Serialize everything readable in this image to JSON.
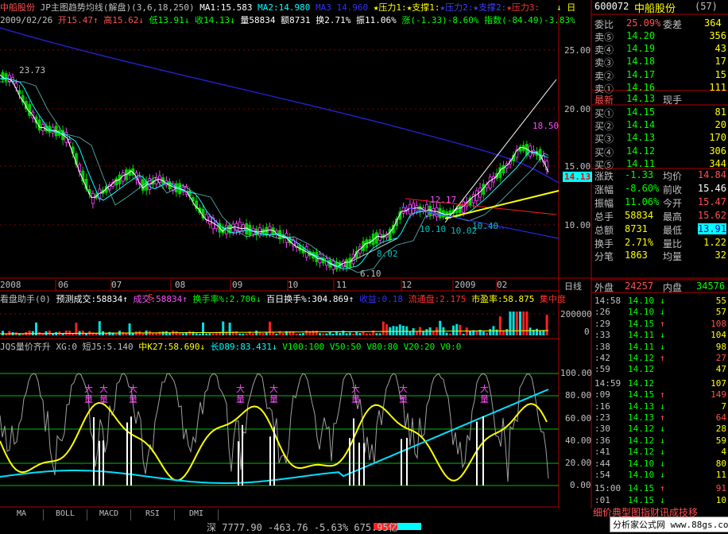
{
  "header": {
    "stock_name": "中船股份",
    "formula": "JP主图趋势均线(解盘)",
    "params": "(3,6,18,250)",
    "ma1": "MA1:15.583",
    "ma2": "MA2:14.980",
    "ma3": "MA3 14.960",
    "pressure1": "★压力1:",
    "support1": "★支撑1:",
    "pressure2": "★压力2:",
    "support2": "★支撑2:",
    "pressure3": "★压力3:",
    "corner_icon": "↓ 日"
  },
  "info_line": {
    "date": "2009/02/26",
    "open": "开15.47↑",
    "high": "高15.62↓",
    "low": "低13.91↓",
    "close": "收14.13↓",
    "volume": "量58834",
    "amount": "额8731",
    "turnover": "换2.71%",
    "amplitude": "振11.06%",
    "change": "涨(-1.33)-8.60%",
    "index": "指数(-84.49)-3.83%"
  },
  "price_axis": [
    "25.00",
    "20.00",
    "15.00",
    "10.00"
  ],
  "current_price_tag": "14.13",
  "price_annotations": {
    "high_a": "23.73",
    "high_b": "18.50",
    "low_a": "6.10",
    "low_b": "8.02",
    "l1": "12.17",
    "l2": "10.10",
    "l3": "10.02",
    "l4": "10.40",
    "s_mark": "S"
  },
  "date_axis": [
    "2008",
    "06",
    "07",
    "08",
    "09",
    "10",
    "11",
    "12",
    "2009",
    "02"
  ],
  "period_label": "日线",
  "vol_panel": {
    "title": "看盘助手(0)",
    "predict": "预测成交:58834↑",
    "deal": "成交:58834↑",
    "turnover_rate": "换手率%:2.706↓",
    "hundred_day": "百日换手%:304.869↑",
    "profit": "收益:0.18",
    "float": "流通盘:2.175",
    "pe": "市盈率:58.875",
    "focus": "集中度",
    "axis": [
      "200000",
      "0"
    ]
  },
  "ind_panel": {
    "title": "JQS量价齐升",
    "xg": "XG:0",
    "short": "短J5:5.140",
    "mid": "中K27:58.690↓",
    "long": "长D89:83.431↓",
    "v100": "V100:100",
    "v50": "V50:50",
    "v80": "V80:80",
    "v20": "V20:20",
    "v0": "V0:0",
    "axis": [
      "100.00",
      "80.00",
      "60.00",
      "40.00",
      "20.00",
      "0.00"
    ],
    "marks": [
      "大量",
      "大量",
      "大量",
      "大量",
      "大量",
      "大量",
      "大量",
      "大量"
    ]
  },
  "tabs": [
    "MA",
    "BOLL",
    "MACD",
    "RSI",
    "DMI"
  ],
  "right_panel": {
    "code": "600072",
    "name": "中船股份",
    "count": "(57)",
    "webi_label": "委比",
    "webi_value": "25.09%",
    "weicha_label": "委差",
    "weicha_value": "364",
    "asks": [
      {
        "label": "卖⑤",
        "price": "14.20",
        "vol": "356"
      },
      {
        "label": "卖④",
        "price": "14.19",
        "vol": "43"
      },
      {
        "label": "卖③",
        "price": "14.18",
        "vol": "17"
      },
      {
        "label": "卖②",
        "price": "14.17",
        "vol": "15"
      },
      {
        "label": "卖①",
        "price": "14.16",
        "vol": "111"
      }
    ],
    "latest": {
      "label": "最新",
      "price": "14.13",
      "extra": "现手"
    },
    "bids": [
      {
        "label": "买①",
        "price": "14.15",
        "vol": "81"
      },
      {
        "label": "买②",
        "price": "14.14",
        "vol": "20"
      },
      {
        "label": "买③",
        "price": "14.13",
        "vol": "170"
      },
      {
        "label": "买④",
        "price": "14.12",
        "vol": "306"
      },
      {
        "label": "买⑤",
        "price": "14.11",
        "vol": "344"
      }
    ],
    "stats": [
      {
        "l1": "涨跌",
        "v1": "-1.33",
        "l2": "均价",
        "v2": "14.84"
      },
      {
        "l1": "涨幅",
        "v1": "-8.60%",
        "l2": "前收",
        "v2": "15.46"
      },
      {
        "l1": "振幅",
        "v1": "11.06%",
        "l2": "今开",
        "v2": "15.47"
      },
      {
        "l1": "总手",
        "v1": "58834",
        "l2": "最高",
        "v2": "15.62"
      },
      {
        "l1": "总额",
        "v1": "8731",
        "l2": "最低",
        "v2": "13.91"
      },
      {
        "l1": "换手",
        "v1": "2.71%",
        "l2": "量比",
        "v2": "1.22"
      },
      {
        "l1": "分笔",
        "v1": "1863",
        "l2": "均量",
        "v2": "32"
      }
    ],
    "outer_label": "外盘",
    "outer_value": "24257",
    "inner_label": "内盘",
    "inner_value": "34576",
    "ticks": [
      {
        "t": "14:58",
        "p": "14.10",
        "d": "↓",
        "v": "55"
      },
      {
        "t": ":26",
        "p": "14.10",
        "d": "↓",
        "v": "57"
      },
      {
        "t": ":29",
        "p": "14.15",
        "d": "↑",
        "v": "108"
      },
      {
        "t": ":33",
        "p": "14.11",
        "d": "↓",
        "v": "104"
      },
      {
        "t": ":38",
        "p": "14.11",
        "d": "↓",
        "v": "98"
      },
      {
        "t": ":42",
        "p": "14.12",
        "d": "↑",
        "v": "27"
      },
      {
        "t": ":59",
        "p": "14.12",
        "d": "",
        "v": "47"
      },
      {
        "t": "14:59",
        "p": "14.12",
        "d": "",
        "v": "107"
      },
      {
        "t": ":09",
        "p": "14.15",
        "d": "↑",
        "v": "149"
      },
      {
        "t": ":16",
        "p": "14.13",
        "d": "↓",
        "v": "7"
      },
      {
        "t": ":23",
        "p": "14.13",
        "d": "↑",
        "v": "64"
      },
      {
        "t": ":30",
        "p": "14.12",
        "d": "↓",
        "v": "28"
      },
      {
        "t": ":36",
        "p": "14.12",
        "d": "↓",
        "v": "59"
      },
      {
        "t": ":41",
        "p": "14.12",
        "d": "↓",
        "v": "4"
      },
      {
        "t": ":44",
        "p": "14.10",
        "d": "↓",
        "v": "80"
      },
      {
        "t": ":54",
        "p": "14.10",
        "d": "↓",
        "v": "11"
      },
      {
        "t": "15:00",
        "p": "14.15",
        "d": "↑",
        "v": "91"
      },
      {
        "t": ":01",
        "p": "14.15",
        "d": "↓",
        "v": "10"
      }
    ],
    "bottom_link": "细价典型图指财讯成技移"
  },
  "status_bar": {
    "text": "深 7777.90  -463.76  -5.63% 675.95亿"
  },
  "watermark": "分析家公式网 www.88gs.com"
}
